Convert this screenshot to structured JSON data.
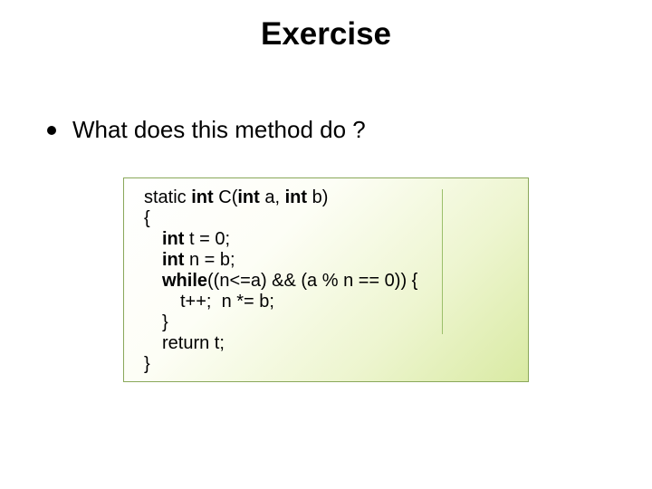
{
  "slide": {
    "title": "Exercise",
    "bullet": "What does this method do ?",
    "code": {
      "l1a": "static ",
      "l1b": "int",
      "l1c": " C(",
      "l1d": "int",
      "l1e": " a, ",
      "l1f": "int",
      "l1g": " b)",
      "l2": "{",
      "l3a": "int",
      "l3b": " t = 0;",
      "l4a": "int",
      "l4b": " n = b;",
      "l5a": "while",
      "l5b": "((n<=a) && (a % n == 0)) {",
      "l6": "t++;  n *= b;",
      "l7": "}",
      "l8": "return t;",
      "l9": "}"
    }
  }
}
